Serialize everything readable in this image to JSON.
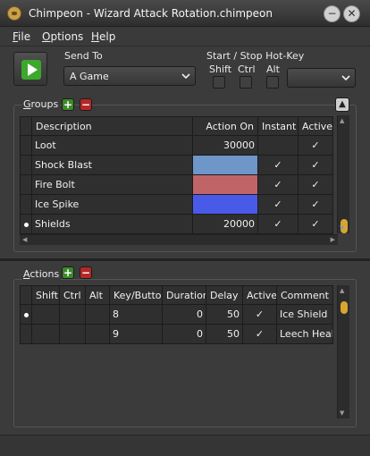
{
  "window": {
    "title": "Chimpeon - Wizard Attack Rotation.chimpeon",
    "min_glyph": "−",
    "close_glyph": "✕"
  },
  "menu": [
    {
      "label": "File",
      "mnemonic": "F",
      "rest": "ile"
    },
    {
      "label": "Options",
      "mnemonic": "O",
      "rest": "ptions"
    },
    {
      "label": "Help",
      "mnemonic": "H",
      "rest": "elp"
    }
  ],
  "send_to": {
    "label": "Send To",
    "value": "A Game"
  },
  "hotkey": {
    "label": "Start / Stop Hot-Key",
    "shift": "Shift",
    "ctrl": "Ctrl",
    "alt": "Alt",
    "key_value": ""
  },
  "groups": {
    "title": "Groups",
    "mnemonic": "G",
    "rest": "roups",
    "add_glyph": "+",
    "remove_glyph": "−",
    "up_glyph": "▲",
    "columns": [
      "Description",
      "Action On",
      "Instant",
      "Active"
    ],
    "rows": [
      {
        "description": "Loot",
        "action_on": "30000",
        "action_color": "",
        "instant": "",
        "active": "✓",
        "selected": false
      },
      {
        "description": "Shock Blast",
        "action_on": "",
        "action_color": "#6e96c8",
        "instant": "✓",
        "active": "✓",
        "selected": false
      },
      {
        "description": "Fire Bolt",
        "action_on": "",
        "action_color": "#c06468",
        "instant": "✓",
        "active": "✓",
        "selected": false
      },
      {
        "description": "Ice Spike",
        "action_on": "",
        "action_color": "#4a5ae8",
        "instant": "✓",
        "active": "✓",
        "selected": false
      },
      {
        "description": "Shields",
        "action_on": "20000",
        "action_color": "",
        "instant": "✓",
        "active": "✓",
        "selected": true
      }
    ]
  },
  "actions": {
    "title": "Actions",
    "mnemonic": "A",
    "rest": "ctions",
    "add_glyph": "+",
    "remove_glyph": "−",
    "columns": [
      "Shift",
      "Ctrl",
      "Alt",
      "Key/Button",
      "Duration",
      "Delay",
      "Active",
      "Comment"
    ],
    "rows": [
      {
        "shift": "",
        "ctrl": "",
        "alt": "",
        "key": "8",
        "duration": "0",
        "delay": "50",
        "active": "✓",
        "comment": "Ice Shield",
        "selected": true
      },
      {
        "shift": "",
        "ctrl": "",
        "alt": "",
        "key": "9",
        "duration": "0",
        "delay": "50",
        "active": "✓",
        "comment": "Leech Healt",
        "selected": false
      }
    ]
  },
  "colors": {
    "accent_green": "#3c8a28",
    "remove_red": "#b42828",
    "scroll_thumb": "#d6a631"
  }
}
